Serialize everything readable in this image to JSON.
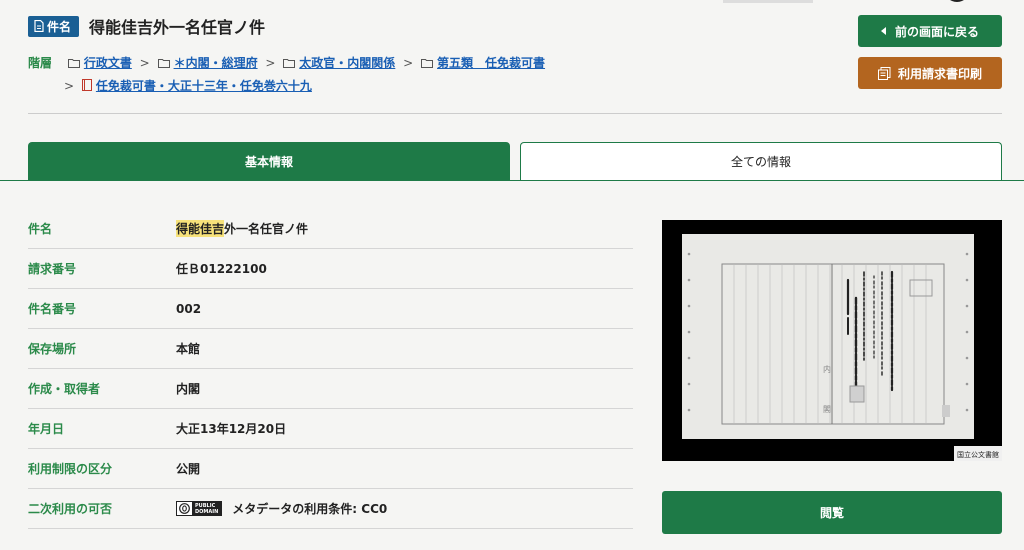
{
  "header": {
    "badge_label": "件名",
    "title": "得能佳吉外一名任官ノ件"
  },
  "breadcrumb": {
    "label": "階層",
    "items": [
      {
        "label": "行政文書"
      },
      {
        "label": "＊内閣・総理府"
      },
      {
        "label": "太政官・内閣関係"
      },
      {
        "label": "第五類　任免裁可書"
      },
      {
        "label": "任免裁可書・大正十三年・任免巻六十九"
      }
    ],
    "separator": ">"
  },
  "buttons": {
    "back": "前の画面に戻る",
    "print": "利用請求書印刷",
    "view": "閲覧"
  },
  "tabs": {
    "basic": "基本情報",
    "all": "全ての情報"
  },
  "info": {
    "rows": [
      {
        "key": "件名",
        "value_highlight": "得能佳吉",
        "value_rest": "外一名任官ノ件"
      },
      {
        "key": "請求番号",
        "value": "任Ｂ01222100"
      },
      {
        "key": "件名番号",
        "value": "002"
      },
      {
        "key": "保存場所",
        "value": "本館"
      },
      {
        "key": "作成・取得者",
        "value": "内閣"
      },
      {
        "key": "年月日",
        "value": "大正13年12月20日"
      },
      {
        "key": "利用制限の区分",
        "value": "公開"
      },
      {
        "key": "二次利用の可否",
        "value": "メタデータの利用条件: CC0"
      }
    ],
    "cc_badge": {
      "line1": "PUBLIC",
      "line2": "DOMAIN"
    }
  },
  "image": {
    "stamp": "国立公文書館",
    "doc_left_char1": "内",
    "doc_left_char2": "閣"
  },
  "colors": {
    "green": "#1e7a47",
    "label_green": "#2b8a4a",
    "brown": "#b3651f",
    "blue_badge": "#1a5f94",
    "link": "#1a5fb4"
  }
}
